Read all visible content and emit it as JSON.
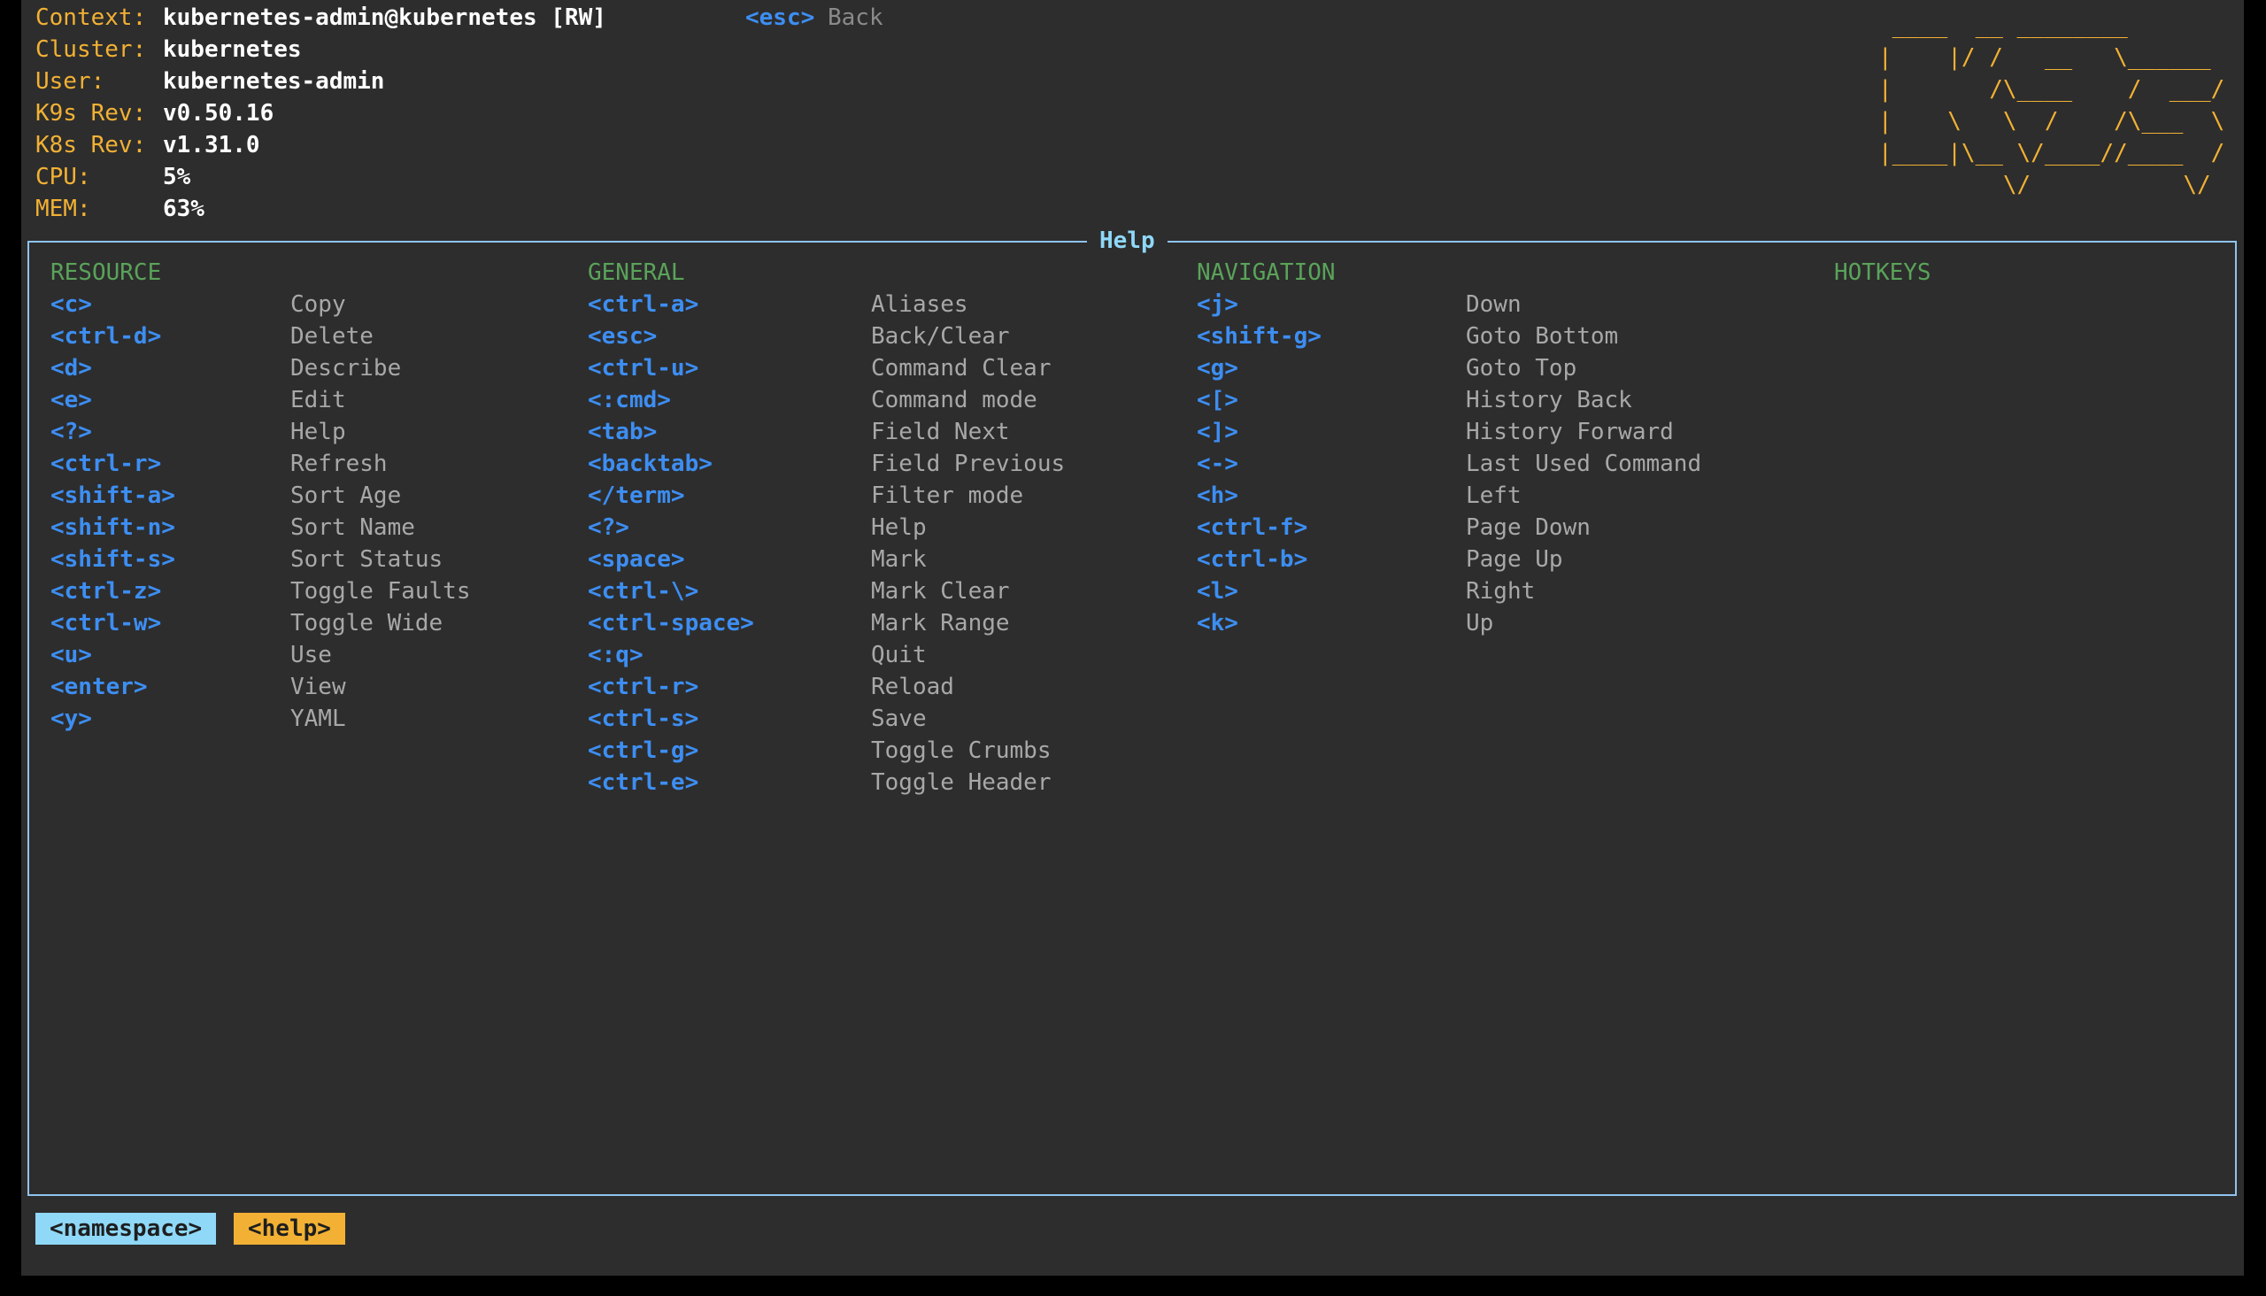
{
  "header": {
    "context": {
      "label": "Context:",
      "value": "kubernetes-admin@kubernetes [RW]"
    },
    "cluster": {
      "label": "Cluster:",
      "value": "kubernetes"
    },
    "user": {
      "label": "User:",
      "value": "kubernetes-admin"
    },
    "k9s_rev": {
      "label": "K9s Rev:",
      "value": "v0.50.16"
    },
    "k8s_rev": {
      "label": "K8s Rev:",
      "value": "v1.31.0"
    },
    "cpu": {
      "label": "CPU:",
      "value": "5%"
    },
    "mem": {
      "label": "MEM:",
      "value": "63%"
    }
  },
  "menu_hint": {
    "key": "<esc>",
    "label": "Back"
  },
  "logo_text": " ____  __ ________\n|    |/ /   __   \\______\n|       /\\____    /  ___/\n|    \\   \\  /    /\\___  \\\n|____|\\__ \\/____//____  /\n         \\/           \\/",
  "help": {
    "title": "Help",
    "resource": {
      "heading": "RESOURCE",
      "items": [
        {
          "key": "<c>",
          "desc": "Copy"
        },
        {
          "key": "<ctrl-d>",
          "desc": "Delete"
        },
        {
          "key": "<d>",
          "desc": "Describe"
        },
        {
          "key": "<e>",
          "desc": "Edit"
        },
        {
          "key": "<?>",
          "desc": "Help"
        },
        {
          "key": "<ctrl-r>",
          "desc": "Refresh"
        },
        {
          "key": "<shift-a>",
          "desc": "Sort Age"
        },
        {
          "key": "<shift-n>",
          "desc": "Sort Name"
        },
        {
          "key": "<shift-s>",
          "desc": "Sort Status"
        },
        {
          "key": "<ctrl-z>",
          "desc": "Toggle Faults"
        },
        {
          "key": "<ctrl-w>",
          "desc": "Toggle Wide"
        },
        {
          "key": "<u>",
          "desc": "Use"
        },
        {
          "key": "<enter>",
          "desc": "View"
        },
        {
          "key": "<y>",
          "desc": "YAML"
        }
      ]
    },
    "general": {
      "heading": "GENERAL",
      "items": [
        {
          "key": "<ctrl-a>",
          "desc": "Aliases"
        },
        {
          "key": "<esc>",
          "desc": "Back/Clear"
        },
        {
          "key": "<ctrl-u>",
          "desc": "Command Clear"
        },
        {
          "key": "<:cmd>",
          "desc": "Command mode"
        },
        {
          "key": "<tab>",
          "desc": "Field Next"
        },
        {
          "key": "<backtab>",
          "desc": "Field Previous"
        },
        {
          "key": "</term>",
          "desc": "Filter mode"
        },
        {
          "key": "<?>",
          "desc": "Help"
        },
        {
          "key": "<space>",
          "desc": "Mark"
        },
        {
          "key": "<ctrl-\\>",
          "desc": "Mark Clear"
        },
        {
          "key": "<ctrl-space>",
          "desc": "Mark Range"
        },
        {
          "key": "<:q>",
          "desc": "Quit"
        },
        {
          "key": "<ctrl-r>",
          "desc": "Reload"
        },
        {
          "key": "<ctrl-s>",
          "desc": "Save"
        },
        {
          "key": "<ctrl-g>",
          "desc": "Toggle Crumbs"
        },
        {
          "key": "<ctrl-e>",
          "desc": "Toggle Header"
        }
      ]
    },
    "navigation": {
      "heading": "NAVIGATION",
      "items": [
        {
          "key": "<j>",
          "desc": "Down"
        },
        {
          "key": "<shift-g>",
          "desc": "Goto Bottom"
        },
        {
          "key": "<g>",
          "desc": "Goto Top"
        },
        {
          "key": "<[>",
          "desc": "History Back"
        },
        {
          "key": "<]>",
          "desc": "History Forward"
        },
        {
          "key": "<->",
          "desc": "Last Used Command"
        },
        {
          "key": "<h>",
          "desc": "Left"
        },
        {
          "key": "<ctrl-f>",
          "desc": "Page Down"
        },
        {
          "key": "<ctrl-b>",
          "desc": "Page Up"
        },
        {
          "key": "<l>",
          "desc": "Right"
        },
        {
          "key": "<k>",
          "desc": "Up"
        }
      ]
    },
    "hotkeys": {
      "heading": "HOTKEYS",
      "items": []
    }
  },
  "crumbs": [
    {
      "label": "<namespace>",
      "color": "#8fd8f8"
    },
    {
      "label": "<help>",
      "color": "#f2b134"
    }
  ],
  "colors": {
    "background": "#2d2d2d",
    "header_label": "#f2b134",
    "key": "#3d8ef2",
    "section": "#5aa35a",
    "frame": "#8fc3ee"
  }
}
